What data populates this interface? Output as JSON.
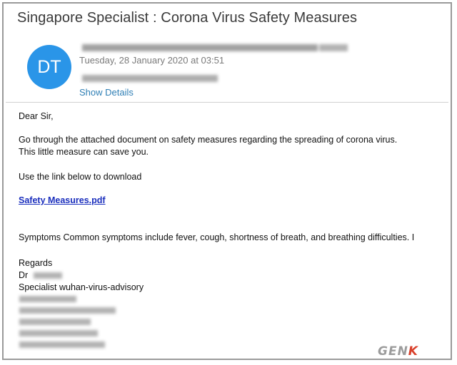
{
  "email": {
    "subject": "Singapore Specialist  : Corona Virus Safety Measures",
    "avatar_initials": "DT",
    "date": "Tuesday, 28 January 2020 at 03:51",
    "show_details": "Show Details",
    "body": {
      "greeting": "Dear Sir,",
      "para1_line1": "Go through the attached document on safety measures regarding the spreading of corona virus.",
      "para1_line2": "This little measure can save you.",
      "link_intro": "Use the link below to download",
      "link_text": "Safety Measures.pdf",
      "symptoms": "Symptoms  Common symptoms include fever, cough, shortness of breath, and breathing difficulties. I",
      "regards": "Regards",
      "dr_prefix": "Dr",
      "signature_title": "Specialist wuhan-virus-advisory"
    }
  },
  "watermark": {
    "gen": "GEN",
    "k": "K"
  },
  "colors": {
    "avatar": "#2a95e8",
    "link": "#1b2fbd",
    "details": "#2f7fb5",
    "brand_k": "#d9402b"
  }
}
